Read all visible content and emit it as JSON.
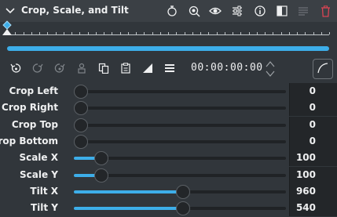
{
  "header": {
    "title": "Crop, Scale, and Tilt",
    "icons": [
      "collapse-chevron-icon",
      "effect-mask-icon",
      "zoom-icon",
      "eye-icon",
      "settings-sliders-icon",
      "info-icon",
      "compare-icon",
      "lines-icon",
      "delete-icon"
    ]
  },
  "timeline": {
    "playhead_position": 0,
    "keyframes": [
      0
    ]
  },
  "toolbar": {
    "timecode": "00:00:00:00",
    "icons": [
      "add-keyframe-icon",
      "previous-keyframe-icon",
      "next-keyframe-icon",
      "keyframe-options-icon",
      "copy-icon",
      "paste-icon",
      "interpolation-icon",
      "menu-icon",
      "curve-icon"
    ]
  },
  "params": [
    {
      "label": "Crop Left",
      "value": "0",
      "level": 0.0
    },
    {
      "label": "Crop Right",
      "value": "0",
      "level": 0.0
    },
    {
      "label": "Crop Top",
      "value": "0",
      "level": 0.0
    },
    {
      "label": "Crop Bottom",
      "value": "0",
      "level": 0.0
    },
    {
      "label": "Scale X",
      "value": "100",
      "level": 0.1
    },
    {
      "label": "Scale Y",
      "value": "100",
      "level": 0.1
    },
    {
      "label": "Tilt X",
      "value": "960",
      "level": 0.5
    },
    {
      "label": "Tilt Y",
      "value": "540",
      "level": 0.5
    }
  ],
  "colors": {
    "accent": "#3daee9",
    "background": "#31363b",
    "header_bg": "#3b4045",
    "delete": "#da4453"
  }
}
